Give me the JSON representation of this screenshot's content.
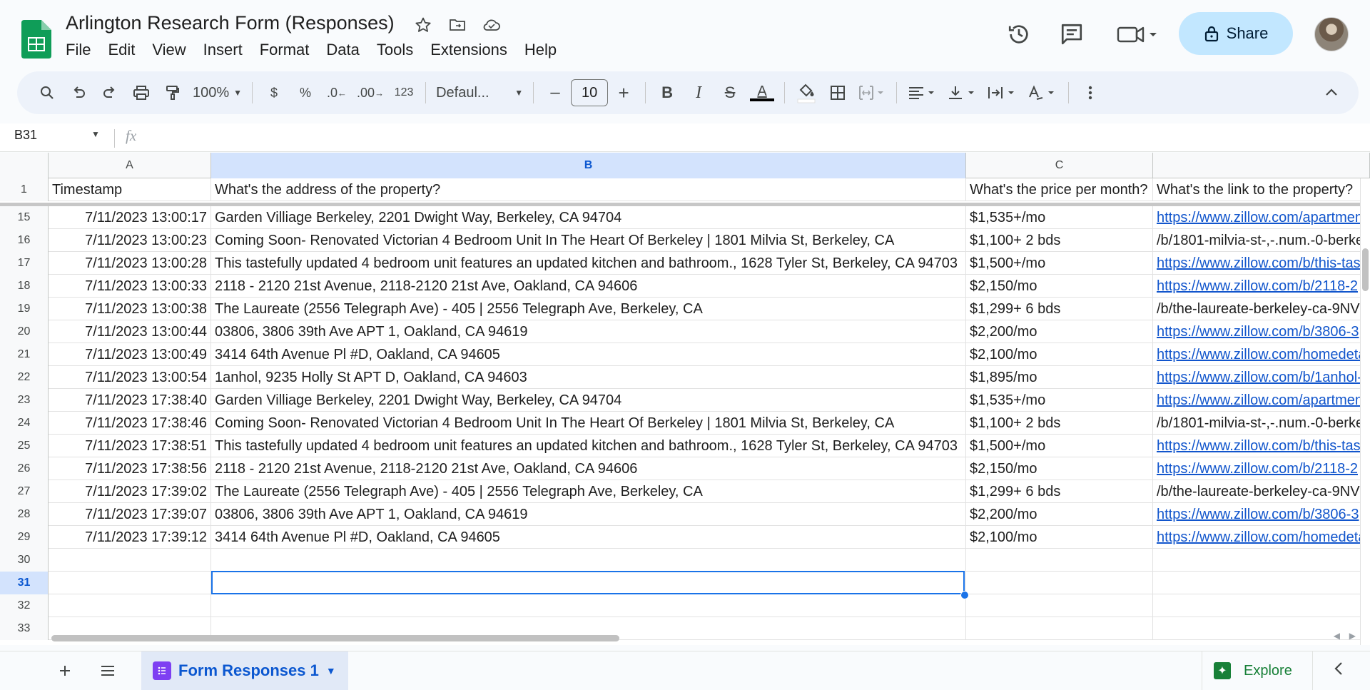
{
  "document": {
    "title": "Arlington Research Form (Responses)"
  },
  "menu": [
    "File",
    "Edit",
    "View",
    "Insert",
    "Format",
    "Data",
    "Tools",
    "Extensions",
    "Help"
  ],
  "header_actions": {
    "share_label": "Share"
  },
  "toolbar": {
    "zoom": "100%",
    "currency": "$",
    "percent": "%",
    "decrease_decimal": ".0",
    "increase_decimal": ".00",
    "more_formats": "123",
    "font": "Defaul...",
    "font_size": "10",
    "minus": "–",
    "plus": "+",
    "bold": "B",
    "italic": "I",
    "strike": "S",
    "text_color_letter": "A",
    "text_color": "#000000"
  },
  "formula_bar": {
    "cell_ref": "B31",
    "fx": "fx",
    "content": ""
  },
  "grid": {
    "columns": [
      "A",
      "B",
      "C",
      ""
    ],
    "selected_column": "B",
    "header_row": {
      "num": "1",
      "cells": [
        "Timestamp",
        "What's the address of the property?",
        "What's the price per month?",
        "What's the link to the property?"
      ]
    },
    "rows": [
      {
        "num": "15",
        "timestamp": "7/11/2023 13:00:17",
        "address": "Garden Villiage Berkeley, 2201 Dwight Way, Berkeley, CA 94704",
        "price": "$1,535+/mo",
        "link": "https://www.zillow.com/apartmen",
        "is_link": true
      },
      {
        "num": "16",
        "timestamp": "7/11/2023 13:00:23",
        "address": "Coming Soon- Renovated Victorian 4 Bedroom Unit In The Heart Of Berkeley | 1801 Milvia St, Berkeley, CA",
        "price": "$1,100+ 2 bds",
        "link": "/b/1801-milvia-st-,-.num.-0-berke",
        "is_link": false
      },
      {
        "num": "17",
        "timestamp": "7/11/2023 13:00:28",
        "address": "This tastefully updated 4 bedroom unit features an updated kitchen and bathroom., 1628 Tyler St, Berkeley, CA 94703",
        "price": "$1,500+/mo",
        "link": "https://www.zillow.com/b/this-tas",
        "is_link": true
      },
      {
        "num": "18",
        "timestamp": "7/11/2023 13:00:33",
        "address": "2118 - 2120 21st Avenue, 2118-2120 21st Ave, Oakland, CA 94606",
        "price": "$2,150/mo",
        "link": "https://www.zillow.com/b/2118-2",
        "is_link": true
      },
      {
        "num": "19",
        "timestamp": "7/11/2023 13:00:38",
        "address": "The Laureate (2556 Telegraph Ave) - 405 | 2556 Telegraph Ave, Berkeley, CA",
        "price": "$1,299+ 6 bds",
        "link": "/b/the-laureate-berkeley-ca-9NV",
        "is_link": false
      },
      {
        "num": "20",
        "timestamp": "7/11/2023 13:00:44",
        "address": "03806, 3806 39th Ave APT 1, Oakland, CA 94619",
        "price": "$2,200/mo",
        "link": "https://www.zillow.com/b/3806-3",
        "is_link": true
      },
      {
        "num": "21",
        "timestamp": "7/11/2023 13:00:49",
        "address": "3414 64th Avenue Pl #D, Oakland, CA 94605",
        "price": "$2,100/mo",
        "link": "https://www.zillow.com/homedeta",
        "is_link": true
      },
      {
        "num": "22",
        "timestamp": "7/11/2023 13:00:54",
        "address": "1anhol, 9235 Holly St APT D, Oakland, CA 94603",
        "price": "$1,895/mo",
        "link": "https://www.zillow.com/b/1anhol-",
        "is_link": true
      },
      {
        "num": "23",
        "timestamp": "7/11/2023 17:38:40",
        "address": "Garden Villiage Berkeley, 2201 Dwight Way, Berkeley, CA 94704",
        "price": "$1,535+/mo",
        "link": "https://www.zillow.com/apartmen",
        "is_link": true
      },
      {
        "num": "24",
        "timestamp": "7/11/2023 17:38:46",
        "address": "Coming Soon- Renovated Victorian 4 Bedroom Unit In The Heart Of Berkeley | 1801 Milvia St, Berkeley, CA",
        "price": "$1,100+ 2 bds",
        "link": "/b/1801-milvia-st-,-.num.-0-berke",
        "is_link": false
      },
      {
        "num": "25",
        "timestamp": "7/11/2023 17:38:51",
        "address": "This tastefully updated 4 bedroom unit features an updated kitchen and bathroom., 1628 Tyler St, Berkeley, CA 94703",
        "price": "$1,500+/mo",
        "link": "https://www.zillow.com/b/this-tas",
        "is_link": true
      },
      {
        "num": "26",
        "timestamp": "7/11/2023 17:38:56",
        "address": "2118 - 2120 21st Avenue, 2118-2120 21st Ave, Oakland, CA 94606",
        "price": "$2,150/mo",
        "link": "https://www.zillow.com/b/2118-2",
        "is_link": true
      },
      {
        "num": "27",
        "timestamp": "7/11/2023 17:39:02",
        "address": "The Laureate (2556 Telegraph Ave) - 405 | 2556 Telegraph Ave, Berkeley, CA",
        "price": "$1,299+ 6 bds",
        "link": "/b/the-laureate-berkeley-ca-9NV",
        "is_link": false
      },
      {
        "num": "28",
        "timestamp": "7/11/2023 17:39:07",
        "address": "03806, 3806 39th Ave APT 1, Oakland, CA 94619",
        "price": "$2,200/mo",
        "link": "https://www.zillow.com/b/3806-3",
        "is_link": true
      },
      {
        "num": "29",
        "timestamp": "7/11/2023 17:39:12",
        "address": "3414 64th Avenue Pl #D, Oakland, CA 94605",
        "price": "$2,100/mo",
        "link": "https://www.zillow.com/homedeta",
        "is_link": true
      },
      {
        "num": "30",
        "timestamp": "",
        "address": "",
        "price": "",
        "link": "",
        "is_link": false
      },
      {
        "num": "31",
        "timestamp": "",
        "address": "",
        "price": "",
        "link": "",
        "is_link": false,
        "selected": true
      },
      {
        "num": "32",
        "timestamp": "",
        "address": "",
        "price": "",
        "link": "",
        "is_link": false
      },
      {
        "num": "33",
        "timestamp": "",
        "address": "",
        "price": "",
        "link": "",
        "is_link": false
      }
    ]
  },
  "sheets": {
    "active": "Form Responses 1",
    "explore_label": "Explore"
  },
  "colors": {
    "accent": "#0b57d0",
    "share_bg": "#c2e7ff",
    "link": "#1155cc",
    "selection": "#1a73e8",
    "sheets_green": "#188038"
  }
}
